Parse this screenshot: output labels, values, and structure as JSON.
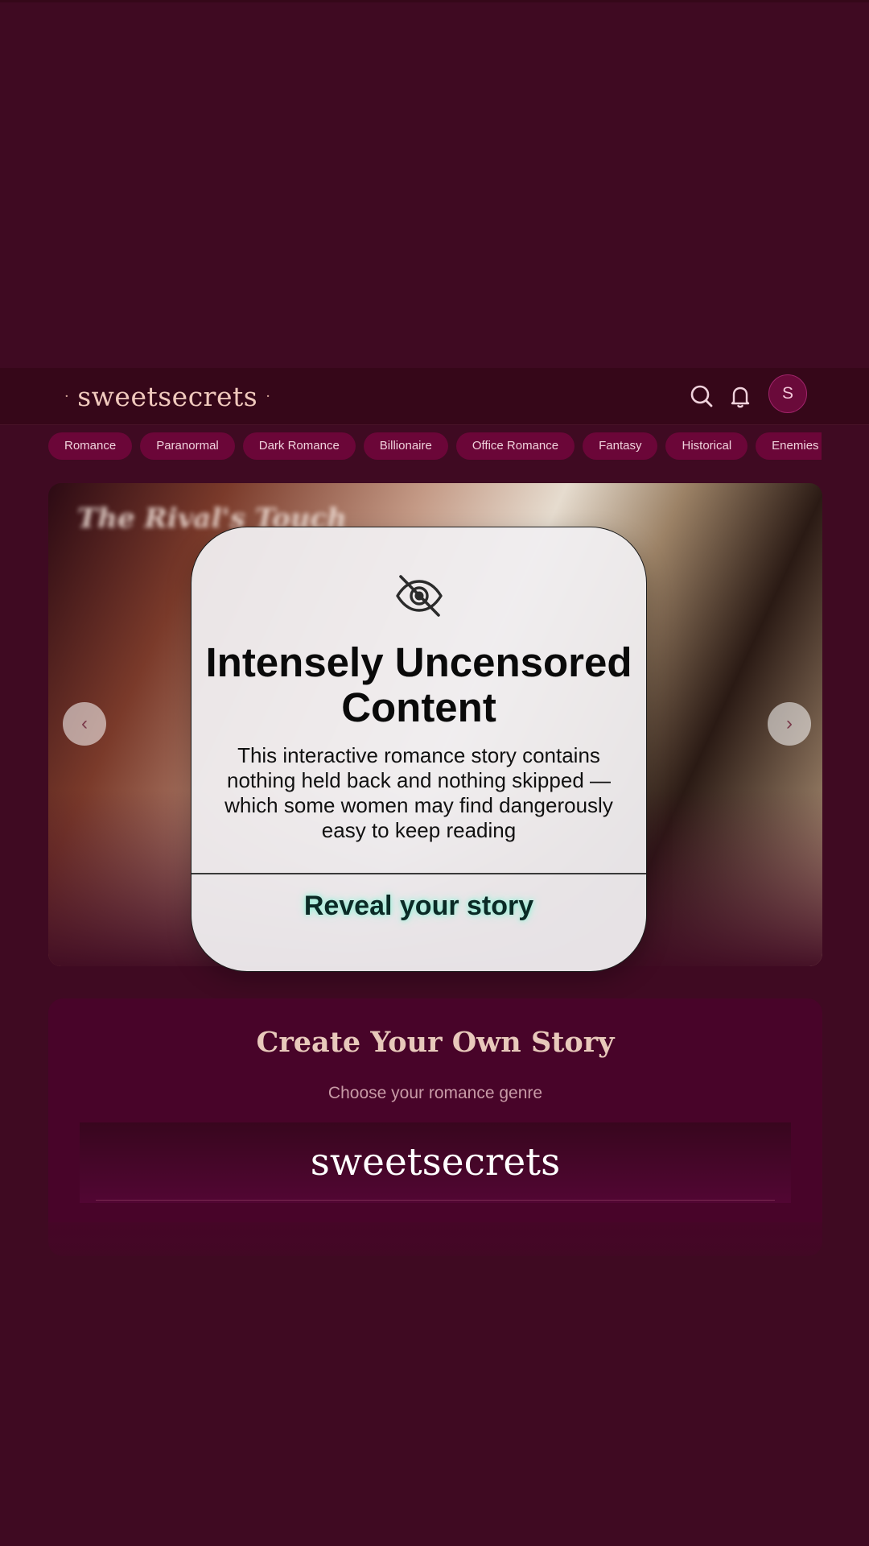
{
  "header": {
    "logo": "sweetsecrets",
    "logo_dot": "·",
    "avatar_initial": "S",
    "icons": [
      "search-icon",
      "bell-icon"
    ]
  },
  "genres": [
    "Romance",
    "Paranormal",
    "Dark Romance",
    "Billionaire",
    "Office Romance",
    "Fantasy",
    "Historical",
    "Enemies"
  ],
  "hero": {
    "title": "The Rival's Touch",
    "desc": "",
    "prev_icon": "‹",
    "next_icon": "›"
  },
  "modal": {
    "icon": "eye-slash-icon",
    "title": "Intensely Uncensored Content",
    "body": "This interactive romance story contains nothing held back and nothing skipped — which some women may find dangerously easy to keep reading",
    "cta": "Reveal your story"
  },
  "create": {
    "title": "Create Your Own Story",
    "subtitle": "Choose your romance genre",
    "logo": "sweetsecrets"
  },
  "colors": {
    "background": "#3f0a22",
    "header": "#360719",
    "chip": "#6b0638",
    "accent_text": "#f0c9bd",
    "cta_glow": "#8ff0d6"
  }
}
